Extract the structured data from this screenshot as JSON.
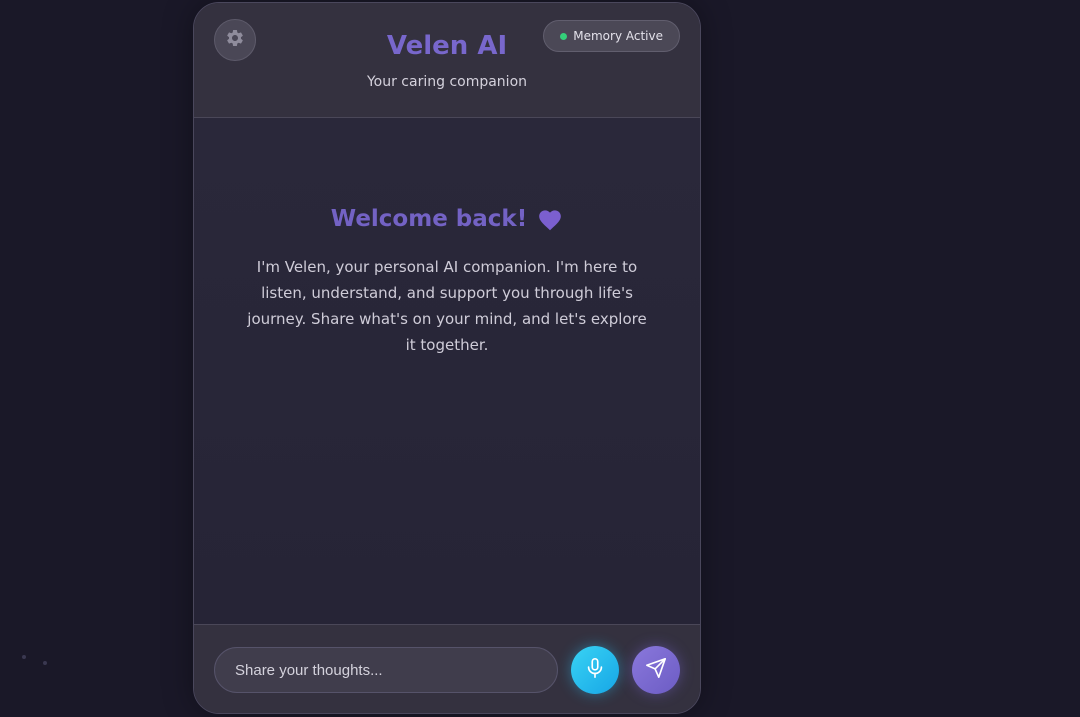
{
  "header": {
    "title": "Velen AI",
    "subtitle": "Your caring companion",
    "memory_status": "Memory Active",
    "memory_status_color": "#34d07a"
  },
  "welcome": {
    "title": "Welcome back!",
    "heart_icon": "purple-heart-icon",
    "message": "I'm Velen, your personal AI companion. I'm here to listen, understand, and support you through life's journey. Share what's on your mind, and let's explore it together."
  },
  "composer": {
    "placeholder": "Share your thoughts...",
    "value": "",
    "mic_icon": "microphone-icon",
    "send_icon": "send-icon"
  },
  "colors": {
    "accent": "#7867cc",
    "mic_button": "#1fb8ec",
    "send_button": "#7a6ad0",
    "background": "#1a1828"
  }
}
